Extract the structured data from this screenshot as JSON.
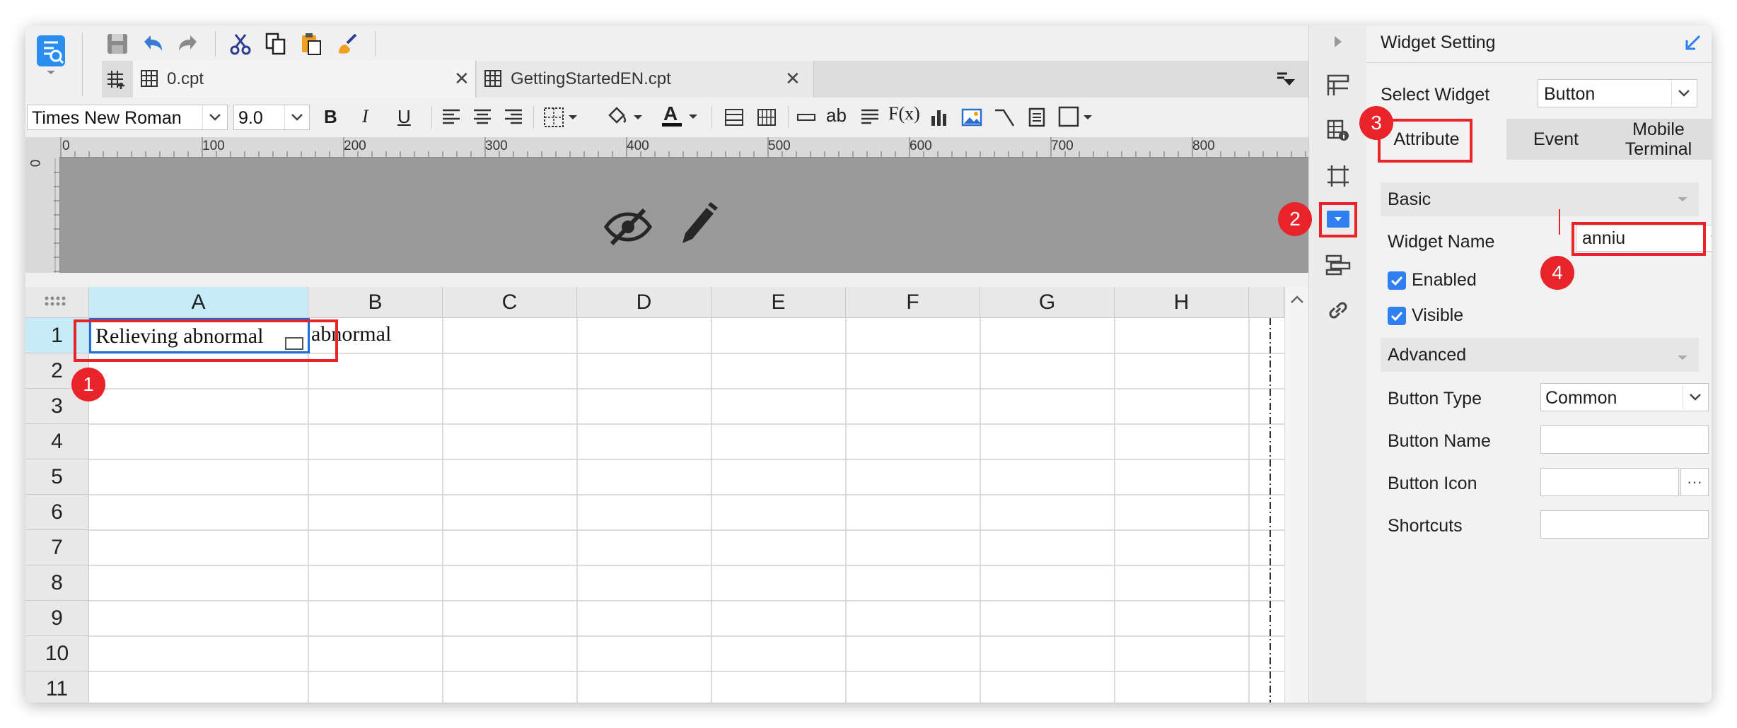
{
  "tabs": [
    {
      "label": "0.cpt",
      "active": true
    },
    {
      "label": "GettingStartedEN.cpt",
      "active": false
    }
  ],
  "format_bar": {
    "font_family": "Times New Roman",
    "font_size": "9.0",
    "bold_label": "B",
    "italic_label": "I",
    "underline_label": "U",
    "text_label": "ab",
    "formula_label": "F(x)"
  },
  "ruler": {
    "h_ticks": [
      "0",
      "100",
      "200",
      "300",
      "400",
      "500",
      "600",
      "700",
      "800"
    ],
    "v_tick": "0"
  },
  "grid": {
    "columns": [
      "A",
      "B",
      "C",
      "D",
      "E",
      "F",
      "G",
      "H"
    ],
    "rows": [
      "1",
      "2",
      "3",
      "4",
      "5",
      "6",
      "7",
      "8",
      "9",
      "10",
      "11"
    ],
    "cells": {
      "A1": "Relieving abnormal",
      "B1": "abnormal"
    }
  },
  "panel": {
    "title": "Widget Setting",
    "select_widget_label": "Select Widget",
    "select_widget_value": "Button",
    "tabs": [
      "Attribute",
      "Event",
      "Mobile Terminal"
    ],
    "sections": {
      "basic": "Basic",
      "advanced": "Advanced"
    },
    "widget_name_label": "Widget Name",
    "widget_name_value": "anniu",
    "enabled_label": "Enabled",
    "visible_label": "Visible",
    "button_type_label": "Button Type",
    "button_type_value": "Common",
    "button_name_label": "Button Name",
    "button_name_value": "",
    "button_icon_label": "Button Icon",
    "button_icon_value": "",
    "button_icon_more": "···",
    "shortcuts_label": "Shortcuts",
    "shortcuts_value": ""
  },
  "annotations": [
    "1",
    "2",
    "3",
    "4"
  ],
  "colors": {
    "accent": "#2f7ff0",
    "annotation_red": "#e8232a",
    "design_area": "#9a9a9a",
    "selected_column_header": "#c6ecfa"
  },
  "icons": [
    "app-logo-icon",
    "save-icon",
    "undo-icon",
    "redo-icon",
    "cut-icon",
    "copy-icon",
    "paste-icon",
    "format-brush-icon",
    "hidden-eye-icon",
    "pencil-icon"
  ]
}
